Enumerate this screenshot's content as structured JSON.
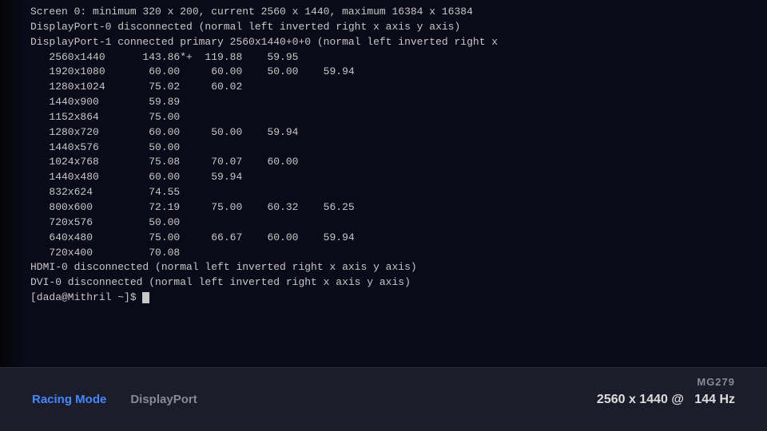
{
  "terminal": {
    "lines": [
      "Screen 0: minimum 320 x 200, current 2560 x 1440, maximum 16384 x 16384",
      "DisplayPort-0 disconnected (normal left inverted right x axis y axis)",
      "DisplayPort-1 connected primary 2560x1440+0+0 (normal left inverted right x",
      "   2560x1440      143.86*+  119.88    59.95",
      "   1920x1080       60.00     60.00    50.00    59.94",
      "   1280x1024       75.02     60.02",
      "   1440x900        59.89",
      "   1152x864        75.00",
      "   1280x720        60.00     50.00    59.94",
      "   1440x576        50.00",
      "   1024x768        75.08     70.07    60.00",
      "   1440x480        60.00     59.94",
      "   832x624         74.55",
      "   800x600         72.19     75.00    60.32    56.25",
      "   720x576         50.00",
      "   640x480         75.00     66.67    60.00    59.94",
      "   720x400         70.08",
      "HDMI-0 disconnected (normal left inverted right x axis y axis)",
      "DVI-0 disconnected (normal left inverted right x axis y axis)",
      "[dada@Mithril ~]$ "
    ]
  },
  "osd": {
    "model": "MG279",
    "mode_label": "Racing Mode",
    "input_label": "DisplayPort",
    "resolution_label": "2560 x 1440 @",
    "refresh_label": "144 Hz"
  }
}
